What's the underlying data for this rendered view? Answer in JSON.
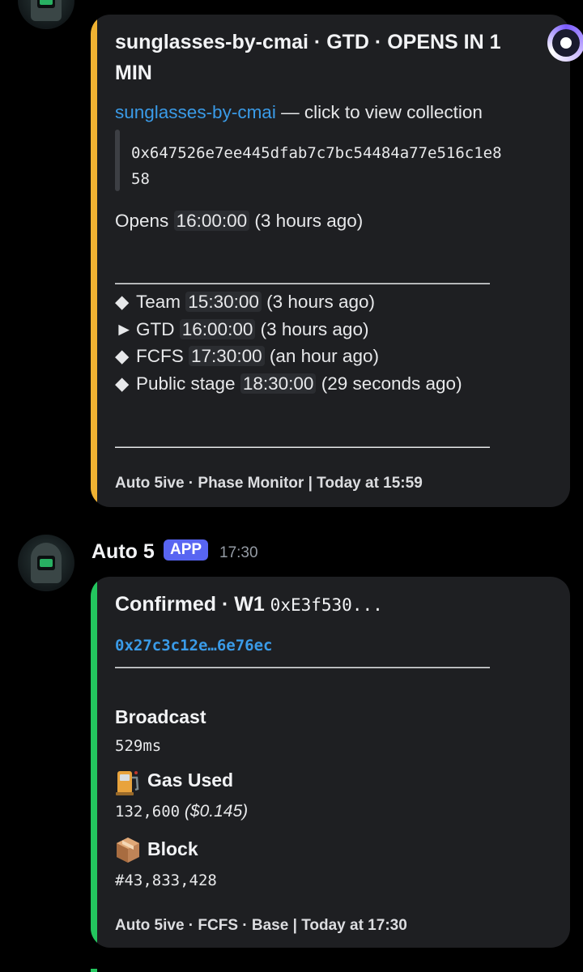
{
  "embed1": {
    "title_line1": "sunglasses-by-cmai · GTD · OPENS IN 1",
    "title_line2": "MIN",
    "collection_link": "sunglasses-by-cmai",
    "collection_suffix": "— click to view collection",
    "address_line1": "0x647526e7ee445dfab7c7bc54484a77e516c1e8",
    "address_line2": "58",
    "opens_label": "Opens",
    "opens_time": "16:00:00",
    "opens_relative": "(3 hours ago)",
    "divider": "——————————————————————",
    "phases": [
      {
        "marker": "◆",
        "name": "Team",
        "time": "15:30:00",
        "relative": "(3 hours ago)"
      },
      {
        "marker": "►",
        "name": "GTD",
        "time": "16:00:00",
        "relative": "(3 hours ago)"
      },
      {
        "marker": "◆",
        "name": "FCFS",
        "time": "17:30:00",
        "relative": "(an hour ago)"
      },
      {
        "marker": "◆",
        "name": "Public stage",
        "time": "18:30:00",
        "relative": "(29 seconds ago)"
      }
    ],
    "footer": "Auto 5ive · Phase Monitor | Today at 15:59",
    "accent_color": "#f0b232"
  },
  "message2": {
    "author": "Auto 5",
    "badge": "APP",
    "timestamp": "17:30"
  },
  "embed2": {
    "title": "Confirmed · W1",
    "title_address": "0xE3f530...",
    "tx_link": "0x27c3c12e…6e76ec",
    "divider": "——————————————————————",
    "broadcast_label": "Broadcast",
    "broadcast_value": "529ms",
    "gas_label": "Gas Used",
    "gas_value": "132,600",
    "gas_usd": "($0.145)",
    "block_label": "Block",
    "block_value": "#43,833,428",
    "footer": "Auto 5ive · FCFS · Base | Today at 17:30",
    "accent_color": "#23c55e",
    "gas_icon": "fuel-pump-icon",
    "block_icon": "package-icon"
  }
}
